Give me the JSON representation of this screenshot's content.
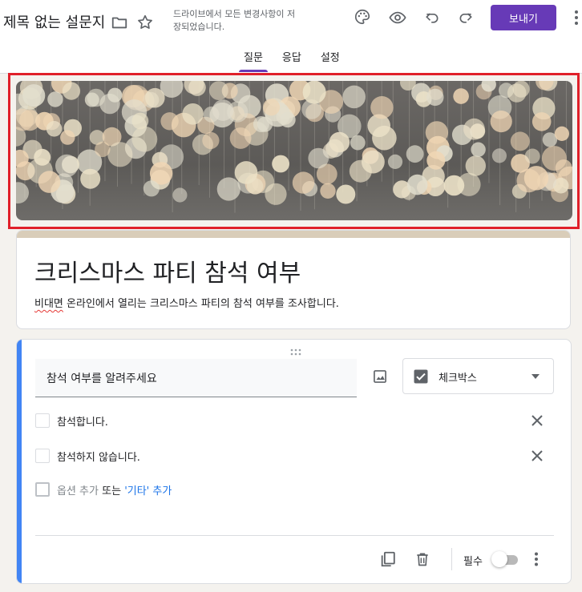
{
  "header": {
    "doc_title": "제목 없는 설문지",
    "save_status": "드라이브에서 모든 변경사항이 저장되었습니다.",
    "send_label": "보내기",
    "icons": [
      "folder-icon",
      "star-icon",
      "palette-icon",
      "preview-eye-icon",
      "undo-icon",
      "redo-icon",
      "more-vert-icon"
    ]
  },
  "tabs": [
    {
      "label": "질문",
      "active": true
    },
    {
      "label": "응답",
      "active": false
    },
    {
      "label": "설정",
      "active": false
    }
  ],
  "form": {
    "title": "크리스마스 파티 참석 여부",
    "description_underlined": "비대면",
    "description_rest": " 온라인에서 열리는 크리스마스 파티의 참석 여부를 조사합니다."
  },
  "question": {
    "title": "참석 여부를 알려주세요",
    "type_label": "체크박스",
    "options": [
      {
        "label": "참석합니다."
      },
      {
        "label": "참석하지 않습니다."
      }
    ],
    "add_option": "옵션 추가",
    "or_text": "또는",
    "add_other": "'기타' 추가",
    "required_label": "필수",
    "required": false
  },
  "colors": {
    "accent": "#673ab7",
    "question_bar": "#4285f4",
    "banner_outline": "#e0202a",
    "theme_stripe": "#d9cdb9",
    "link": "#1a73e8"
  }
}
